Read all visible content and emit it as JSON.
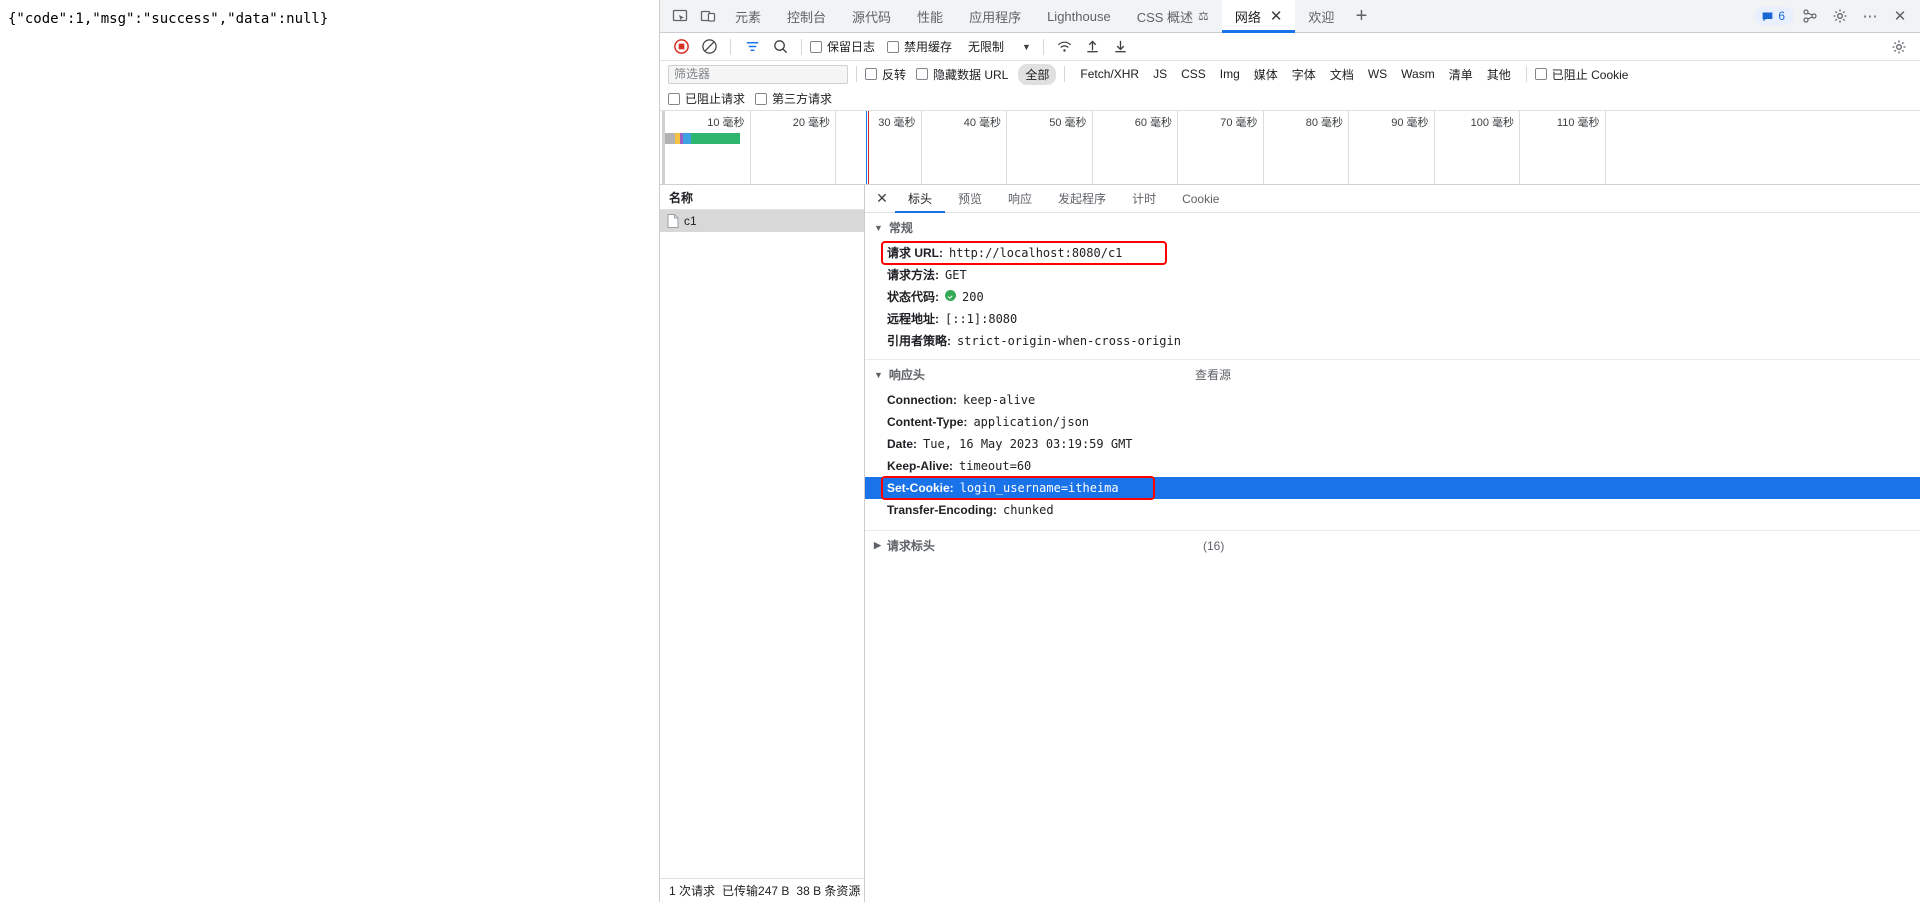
{
  "page": {
    "response_text": "{\"code\":1,\"msg\":\"success\",\"data\":null}"
  },
  "devtools": {
    "tabs": [
      {
        "label": "元素",
        "active": false
      },
      {
        "label": "控制台",
        "active": false
      },
      {
        "label": "源代码",
        "active": false
      },
      {
        "label": "性能",
        "active": false
      },
      {
        "label": "应用程序",
        "active": false
      },
      {
        "label": "Lighthouse",
        "active": false
      },
      {
        "label": "CSS 概述",
        "active": false,
        "icon": "beaker-icon"
      },
      {
        "label": "网络",
        "active": true,
        "closable": true
      },
      {
        "label": "欢迎",
        "active": false
      }
    ],
    "add_tab_label": "+",
    "issues_count": "6",
    "toolbar": {
      "record_title": "record-stop",
      "clear_title": "clear",
      "filter_title": "filter",
      "search_title": "search",
      "preserve_log_label": "保留日志",
      "disable_cache_label": "禁用缓存",
      "throttle_value": "无限制",
      "caret": "▼"
    },
    "filterbar": {
      "filter_placeholder": "筛选器",
      "invert_label": "反转",
      "hide_data_urls_label": "隐藏数据 URL",
      "types": [
        {
          "label": "全部",
          "selected": true
        },
        {
          "label": "Fetch/XHR",
          "selected": false
        },
        {
          "label": "JS",
          "selected": false
        },
        {
          "label": "CSS",
          "selected": false
        },
        {
          "label": "Img",
          "selected": false
        },
        {
          "label": "媒体",
          "selected": false
        },
        {
          "label": "字体",
          "selected": false
        },
        {
          "label": "文档",
          "selected": false
        },
        {
          "label": "WS",
          "selected": false
        },
        {
          "label": "Wasm",
          "selected": false
        },
        {
          "label": "清单",
          "selected": false
        },
        {
          "label": "其他",
          "selected": false
        }
      ],
      "blocked_cookies_label": "已阻止 Cookie",
      "blocked_requests_label": "已阻止请求",
      "third_party_label": "第三方请求"
    },
    "overview": {
      "ticks": [
        "10 毫秒",
        "20 毫秒",
        "30 毫秒",
        "40 毫秒",
        "50 毫秒",
        "60 毫秒",
        "70 毫秒",
        "80 毫秒",
        "90 毫秒",
        "100 毫秒",
        "110 毫秒"
      ],
      "bar_segments": [
        {
          "color": "#b3b3b3",
          "width": 10
        },
        {
          "color": "#f6c244",
          "width": 5
        },
        {
          "color": "#9e5ec2",
          "width": 3
        },
        {
          "color": "#3da3e0",
          "width": 8
        },
        {
          "color": "#2fb66e",
          "width": 49
        }
      ],
      "marker_blue": "#1a73e8",
      "marker_red": "#c62828"
    },
    "request_list": {
      "header": "名称",
      "rows": [
        {
          "name": "c1",
          "icon": "document-icon",
          "selected": true
        }
      ],
      "status": [
        "1 次请求",
        "已传输247 B",
        "38 B 条资源"
      ]
    },
    "detail": {
      "tabs": [
        {
          "label": "标头",
          "active": true
        },
        {
          "label": "预览",
          "active": false
        },
        {
          "label": "响应",
          "active": false
        },
        {
          "label": "发起程序",
          "active": false
        },
        {
          "label": "计时",
          "active": false
        },
        {
          "label": "Cookie",
          "active": false
        }
      ],
      "sections": [
        {
          "title": "常规",
          "expanded": true,
          "rows": [
            {
              "key": "请求 URL:",
              "value": "http://localhost:8080/c1",
              "highlight": "box"
            },
            {
              "key": "请求方法:",
              "value": "GET"
            },
            {
              "key": "状态代码:",
              "value": "200",
              "status_icon": true
            },
            {
              "key": "远程地址:",
              "value": "[::1]:8080"
            },
            {
              "key": "引用者策略:",
              "value": "strict-origin-when-cross-origin"
            }
          ]
        },
        {
          "title": "响应头",
          "expanded": true,
          "extra": "查看源",
          "rows": [
            {
              "key": "Connection:",
              "value": "keep-alive"
            },
            {
              "key": "Content-Type:",
              "value": "application/json"
            },
            {
              "key": "Date:",
              "value": "Tue, 16 May 2023 03:19:59 GMT"
            },
            {
              "key": "Keep-Alive:",
              "value": "timeout=60"
            },
            {
              "key": "Set-Cookie:",
              "value": "login_username=itheima",
              "highlight": "selected-box"
            },
            {
              "key": "Transfer-Encoding:",
              "value": "chunked"
            }
          ]
        },
        {
          "title": "请求标头",
          "expanded": false,
          "count": "(16)",
          "rows": []
        }
      ]
    }
  }
}
